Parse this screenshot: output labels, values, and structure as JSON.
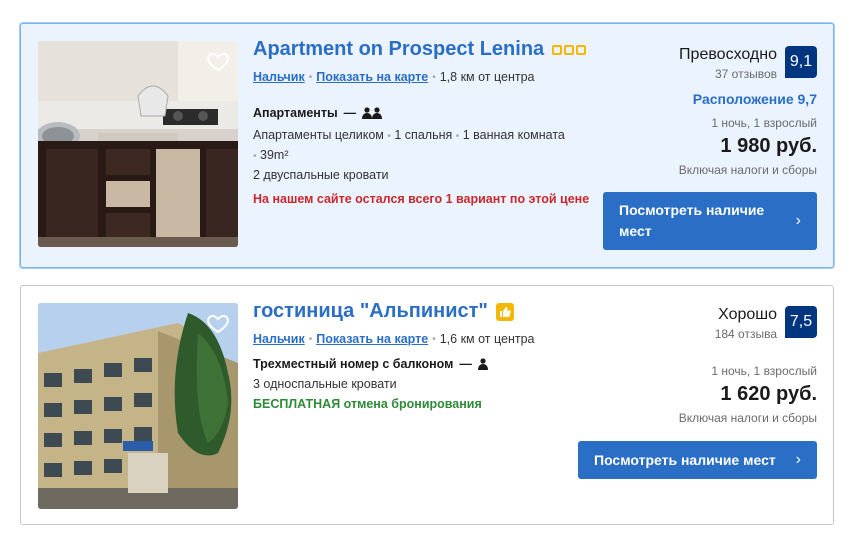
{
  "listings": [
    {
      "title": "Apartment on Prospect Lenina",
      "city": "Нальчик",
      "map_link": "Показать на карте",
      "distance": "1,8 км от центра",
      "room_type": "Апартаменты",
      "dash": "—",
      "details_line1": "Апартаменты целиком",
      "detail_bedroom": "1 спальня",
      "detail_bathroom": "1 ванная комната",
      "detail_area": "39m²",
      "beds": "2 двуспальные кровати",
      "alert": "На нашем сайте остался всего 1 вариант по этой цене",
      "rating_word": "Превосходно",
      "reviews": "37 отзывов",
      "score": "9,1",
      "location_score": "Расположение 9,7",
      "stay": "1 ночь, 1 взрослый",
      "price": "1 980 руб.",
      "taxes": "Включая налоги и сборы",
      "button": "Посмотреть наличие мест"
    },
    {
      "title": "гостиница \"Альпинист\"",
      "city": "Нальчик",
      "map_link": "Показать на карте",
      "distance": "1,6 км от центра",
      "room_type": "Трехместный номер с балконом",
      "dash": "—",
      "beds": "3 односпальные кровати",
      "free_cancel": "БЕСПЛАТНАЯ отмена бронирования",
      "rating_word": "Хорошо",
      "reviews": "184 отзыва",
      "score": "7,5",
      "stay": "1 ночь, 1 взрослый",
      "price": "1 620 руб.",
      "taxes": "Включая налоги и сборы",
      "button": "Посмотреть наличие мест"
    }
  ],
  "colors": {
    "link": "#2a6ec6",
    "score_bg": "#003580",
    "alert": "#c8282c",
    "free": "#2f8a38",
    "highlight_bg": "#ebf3ff"
  },
  "icons": [
    "heart-icon",
    "star-square-icon",
    "thumbs-up-icon",
    "person-icon",
    "chevron-right-icon"
  ]
}
